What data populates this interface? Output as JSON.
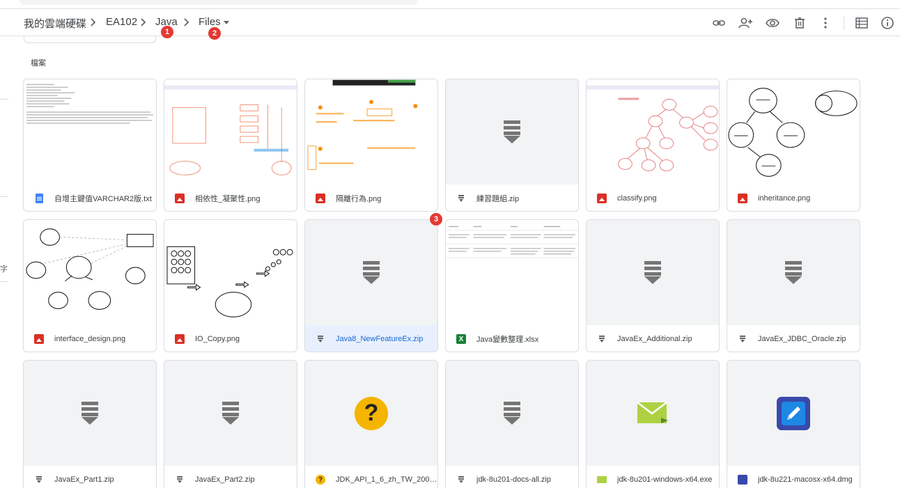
{
  "breadcrumb": {
    "root": "我的雲端硬碟",
    "items": [
      "EA102",
      "Java",
      "Files"
    ]
  },
  "badges": [
    "1",
    "2",
    "3"
  ],
  "toolbar": {
    "icons": [
      "link-icon",
      "add-person-icon",
      "eye-icon",
      "trash-icon",
      "more-vert-icon",
      "list-view-icon",
      "info-icon"
    ]
  },
  "sidebar": {
    "fragment": "字"
  },
  "section": {
    "label": "檔案"
  },
  "files": [
    {
      "name": "自增主鍵值VARCHAR2版.txt",
      "type": "doc"
    },
    {
      "name": "相依性_凝聚性.png",
      "type": "image"
    },
    {
      "name": "隔離行為.png",
      "type": "image"
    },
    {
      "name": "練習題組.zip",
      "type": "zip"
    },
    {
      "name": "classify.png",
      "type": "image"
    },
    {
      "name": "inheritance.png",
      "type": "image"
    },
    {
      "name": "interface_design.png",
      "type": "image"
    },
    {
      "name": "IO_Copy.png",
      "type": "image"
    },
    {
      "name": "Java8_NewFeatureEx.zip",
      "type": "zip",
      "selected": true
    },
    {
      "name": "Java變數整理.xlsx",
      "type": "xlsx"
    },
    {
      "name": "JavaEx_Additional.zip",
      "type": "zip"
    },
    {
      "name": "JavaEx_JDBC_Oracle.zip",
      "type": "zip"
    },
    {
      "name": "JavaEx_Part1.zip",
      "type": "zip"
    },
    {
      "name": "JavaEx_Part2.zip",
      "type": "zip"
    },
    {
      "name": "JDK_API_1_6_zh_TW_2008...",
      "type": "unknown"
    },
    {
      "name": "jdk-8u201-docs-all.zip",
      "type": "zip"
    },
    {
      "name": "jdk-8u201-windows-x64.exe",
      "type": "exe"
    },
    {
      "name": "jdk-8u221-macosx-x64.dmg",
      "type": "dmg"
    }
  ],
  "thumb_text": {
    "question": "?"
  },
  "colors": {
    "image_icon": "#d93025",
    "doc_icon": "#4285f4",
    "xlsx_icon": "#188038",
    "selected_bg": "#e8f0fe",
    "selected_text": "#1967d2",
    "badge": "#e53935"
  }
}
